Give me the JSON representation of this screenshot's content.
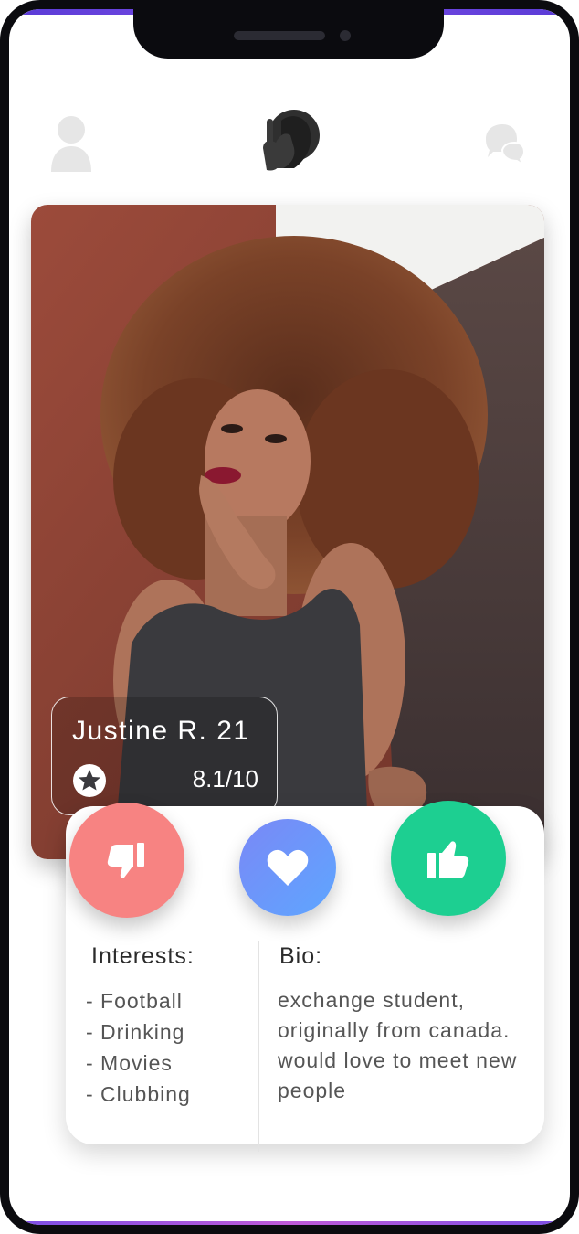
{
  "profile": {
    "name_age": "Justine R. 21",
    "rating": "8.1/10"
  },
  "actions": {
    "dislike_icon": "thumbs-down-icon",
    "favorite_icon": "heart-icon",
    "like_icon": "thumbs-up-icon"
  },
  "details": {
    "interests_heading": "Interests:",
    "interests": [
      "- Football",
      "- Drinking",
      "- Movies",
      "- Clubbing"
    ],
    "bio_heading": "Bio:",
    "bio": "exchange student, originally from canada. would love to meet new people"
  },
  "colors": {
    "dislike": "#f78382",
    "favorite": "#6b96fa",
    "like": "#1dcf91",
    "frame_accent": "#5a3bd6"
  }
}
